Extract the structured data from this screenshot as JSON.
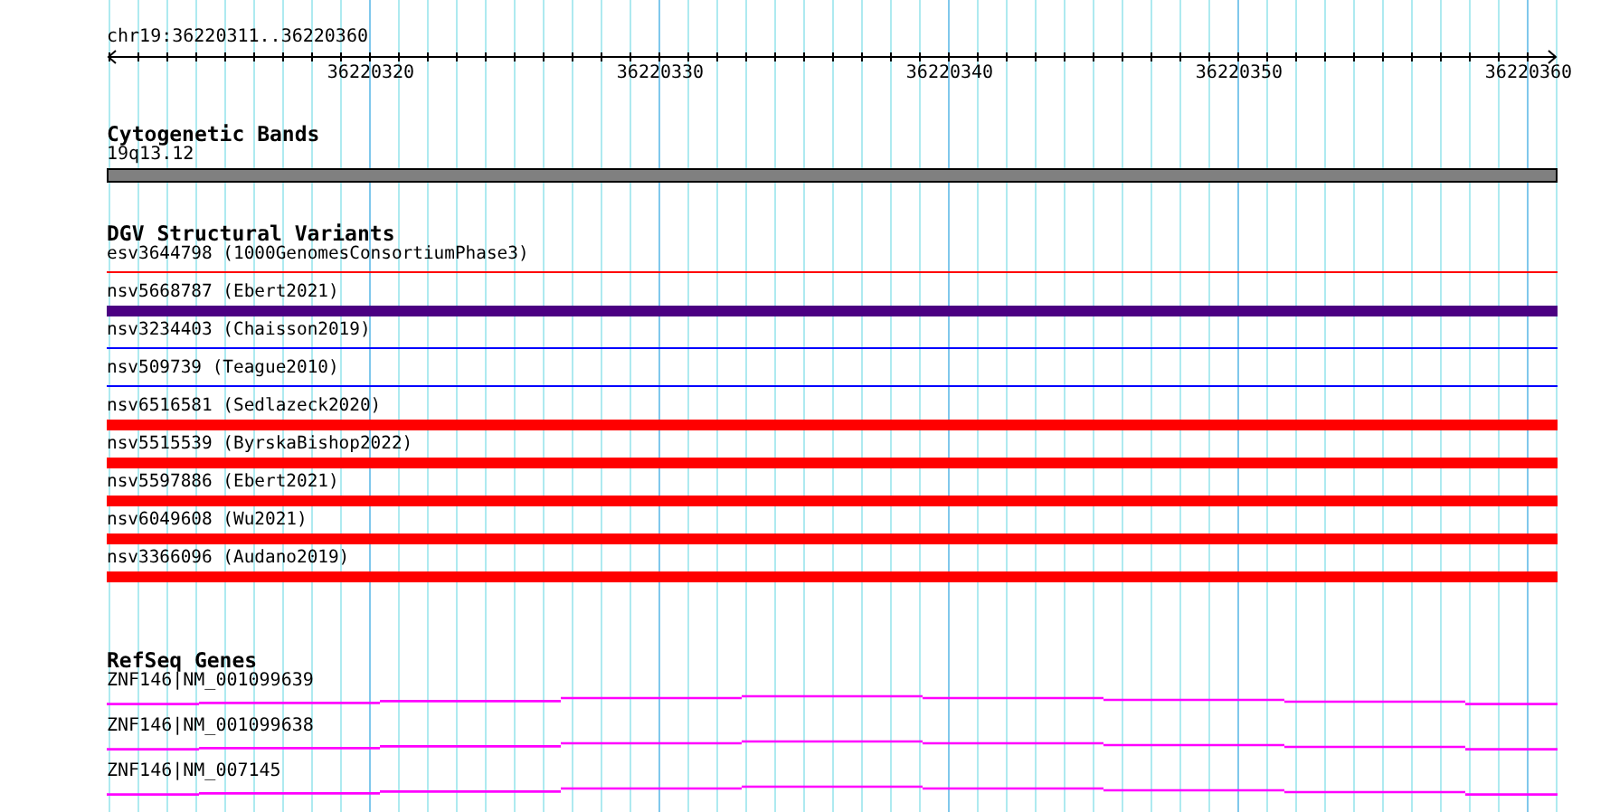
{
  "ruler": {
    "location": "chr19:36220311..36220360",
    "labels": [
      "36220320",
      "36220330",
      "36220340",
      "36220350",
      "36220360"
    ]
  },
  "cytogenetic_bands": {
    "title": "Cytogenetic Bands",
    "bands": [
      {
        "label": "19q13.12"
      }
    ]
  },
  "dgv": {
    "title": "DGV Structural Variants",
    "variants": [
      {
        "label": "esv3644798 (1000GenomesConsortiumPhase3)",
        "kind": "thin",
        "color": "#ff0000"
      },
      {
        "label": "nsv5668787 (Ebert2021)",
        "kind": "thick",
        "color": "#4b0082"
      },
      {
        "label": "nsv3234403 (Chaisson2019)",
        "kind": "thin",
        "color": "#0000ff"
      },
      {
        "label": "nsv509739 (Teague2010)",
        "kind": "thin",
        "color": "#0000ff"
      },
      {
        "label": "nsv6516581 (Sedlazeck2020)",
        "kind": "thick",
        "color": "#ff0000"
      },
      {
        "label": "nsv5515539 (ByrskaBishop2022)",
        "kind": "thick",
        "color": "#ff0000"
      },
      {
        "label": "nsv5597886 (Ebert2021)",
        "kind": "thick",
        "color": "#ff0000"
      },
      {
        "label": "nsv6049608 (Wu2021)",
        "kind": "thick",
        "color": "#ff0000"
      },
      {
        "label": "nsv3366096 (Audano2019)",
        "kind": "thick",
        "color": "#ff0000"
      }
    ]
  },
  "refseq": {
    "title": "RefSeq Genes",
    "genes": [
      {
        "label": "ZNF146|NM_001099639"
      },
      {
        "label": "ZNF146|NM_001099638"
      },
      {
        "label": "ZNF146|NM_007145"
      }
    ]
  }
}
